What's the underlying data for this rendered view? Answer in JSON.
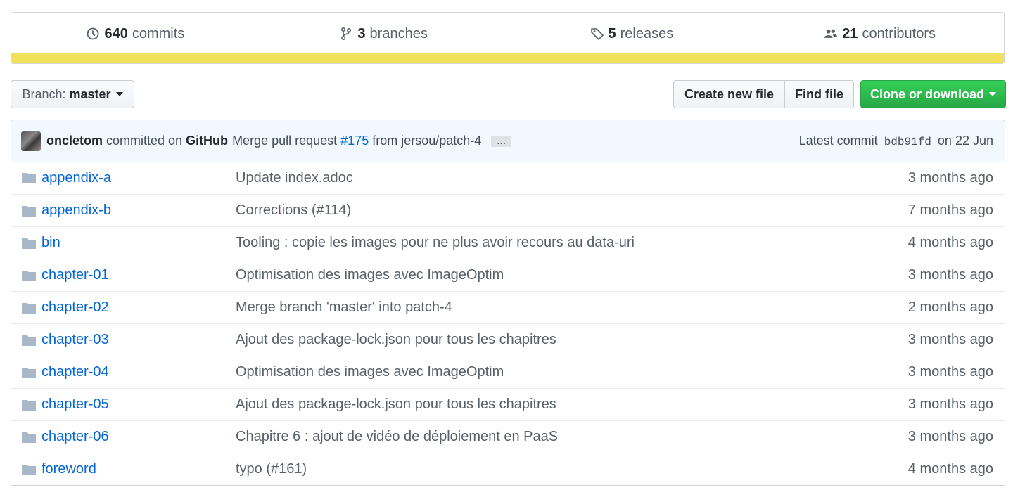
{
  "stats": {
    "commits_count": "640",
    "commits_label": "commits",
    "branches_count": "3",
    "branches_label": "branches",
    "releases_count": "5",
    "releases_label": "releases",
    "contributors_count": "21",
    "contributors_label": "contributors"
  },
  "language_bar_color": "#f1e05a",
  "branch": {
    "prefix": "Branch:",
    "name": "master"
  },
  "buttons": {
    "create_new_file": "Create new file",
    "find_file": "Find file",
    "clone_or_download": "Clone or download"
  },
  "commit": {
    "author": "oncletom",
    "committed_on": "committed on",
    "platform": "GitHub",
    "message_prefix": "Merge pull request",
    "pr": "#175",
    "message_suffix": "from jersou/patch-4",
    "ellipsis": "…",
    "latest_label": "Latest commit",
    "sha": "bdb91fd",
    "date": "on 22 Jun"
  },
  "files": [
    {
      "name": "appendix-a",
      "message": "Update index.adoc",
      "age": "3 months ago"
    },
    {
      "name": "appendix-b",
      "message": "Corrections (#114)",
      "age": "7 months ago"
    },
    {
      "name": "bin",
      "message": "Tooling : copie les images pour ne plus avoir recours au data-uri",
      "age": "4 months ago"
    },
    {
      "name": "chapter-01",
      "message": "Optimisation des images avec ImageOptim",
      "age": "3 months ago"
    },
    {
      "name": "chapter-02",
      "message": "Merge branch 'master' into patch-4",
      "age": "2 months ago"
    },
    {
      "name": "chapter-03",
      "message": "Ajout des package-lock.json pour tous les chapitres",
      "age": "3 months ago"
    },
    {
      "name": "chapter-04",
      "message": "Optimisation des images avec ImageOptim",
      "age": "3 months ago"
    },
    {
      "name": "chapter-05",
      "message": "Ajout des package-lock.json pour tous les chapitres",
      "age": "3 months ago"
    },
    {
      "name": "chapter-06",
      "message": "Chapitre 6 : ajout de vidéo de déploiement en PaaS",
      "age": "3 months ago"
    },
    {
      "name": "foreword",
      "message": "typo (#161)",
      "age": "4 months ago"
    }
  ]
}
